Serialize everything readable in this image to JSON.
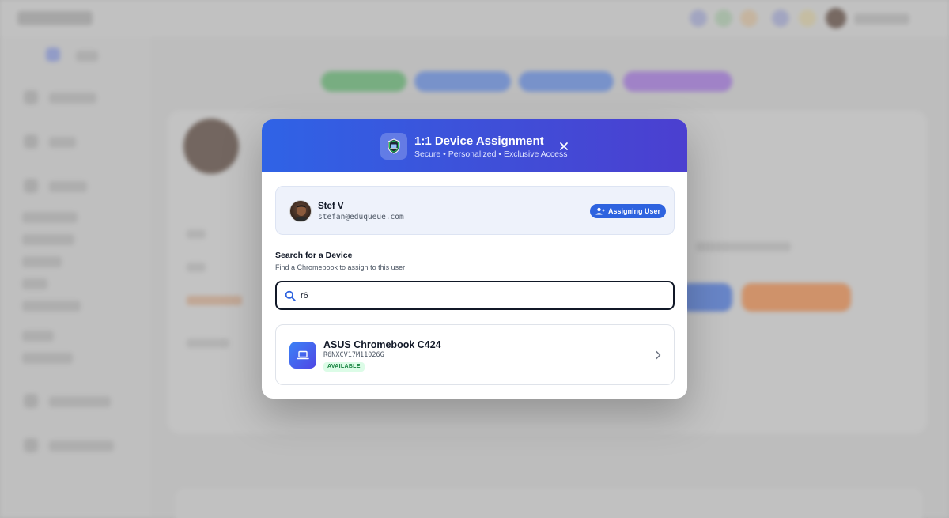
{
  "modal": {
    "title": "1:1 Device Assignment",
    "subtitle": "Secure • Personalized • Exclusive Access",
    "header_icon": "shield-device-icon",
    "close_icon": "close-icon"
  },
  "user": {
    "name": "Stef V",
    "email": "stefan@eduqueue.com",
    "badge_label": "Assigning User",
    "badge_icon": "user-plus-icon"
  },
  "search": {
    "title": "Search for a Device",
    "subtitle": "Find a Chromebook to assign to this user",
    "value": "r6",
    "icon": "search-icon"
  },
  "results": [
    {
      "name": "ASUS Chromebook C424",
      "serial": "R6NXCV17M11026G",
      "status": "AVAILABLE",
      "icon": "laptop-icon"
    }
  ],
  "colors": {
    "header_start": "#2f63e6",
    "header_end": "#4b3fd0",
    "accent": "#2e63df",
    "available_bg": "#dcfce7",
    "available_text": "#15803d"
  }
}
